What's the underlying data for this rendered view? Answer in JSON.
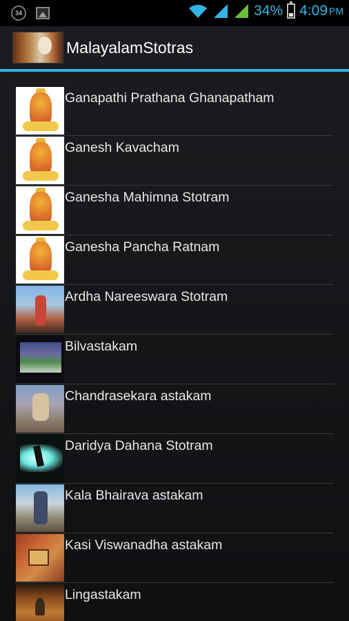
{
  "status_bar": {
    "notification_badge": "34",
    "battery_percent": "34%",
    "time": "4:09",
    "time_suffix": "PM",
    "accent_color": "#33b5e5"
  },
  "action_bar": {
    "title": "MalayalamStotras",
    "accent_color": "#33b5e5"
  },
  "list": {
    "items": [
      {
        "label": "Ganapathi Prathana Ghanapatham",
        "thumb_icon": "ganesha-image"
      },
      {
        "label": "Ganesh Kavacham",
        "thumb_icon": "ganesha-image"
      },
      {
        "label": "Ganesha Mahimna Stotram",
        "thumb_icon": "ganesha-image"
      },
      {
        "label": "Ganesha Pancha Ratnam",
        "thumb_icon": "ganesha-image"
      },
      {
        "label": "Ardha Nareeswara Stotram",
        "thumb_icon": "ardhanareeswara-image"
      },
      {
        "label": "Bilvastakam",
        "thumb_icon": "bilva-image"
      },
      {
        "label": "Chandrasekara astakam",
        "thumb_icon": "chandrasekara-image"
      },
      {
        "label": "Daridya Dahana Stotram",
        "thumb_icon": "dancing-shiva-image"
      },
      {
        "label": "Kala Bhairava astakam",
        "thumb_icon": "kala-bhairava-image"
      },
      {
        "label": "Kasi Viswanadha astakam",
        "thumb_icon": "kasi-temple-image"
      },
      {
        "label": "Lingastakam",
        "thumb_icon": "lingam-image"
      }
    ]
  }
}
